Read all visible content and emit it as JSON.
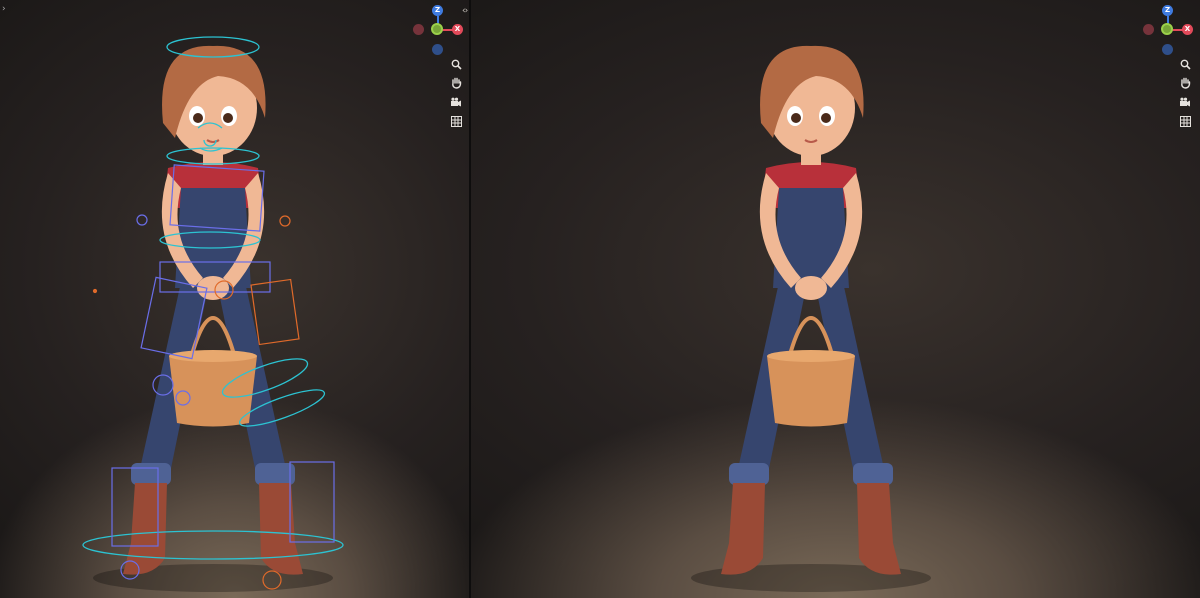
{
  "viewports": {
    "left": {
      "name": "rig-viewport",
      "gizmo": {
        "z_label": "Z",
        "x_label": "X"
      },
      "tools": [
        "zoom-icon",
        "hand-icon",
        "camera-icon",
        "grid-icon"
      ],
      "overlay": "rig-controls"
    },
    "right": {
      "name": "render-viewport",
      "gizmo": {
        "z_label": "Z",
        "x_label": "X"
      },
      "tools": [
        "zoom-icon",
        "hand-icon",
        "camera-icon",
        "grid-icon"
      ]
    }
  },
  "divider_arrows": "‹›",
  "edge_arrow": "›",
  "colors": {
    "shirt": "#b8303a",
    "denim": "#36456e",
    "bucket": "#d7925a",
    "boots": "#9a4a36",
    "hair": "#b36a44",
    "skin": "#f0b895",
    "rig_cyan": "#2cc3d2",
    "rig_blue": "#6a6ee8",
    "rig_orange": "#e06a2a"
  }
}
